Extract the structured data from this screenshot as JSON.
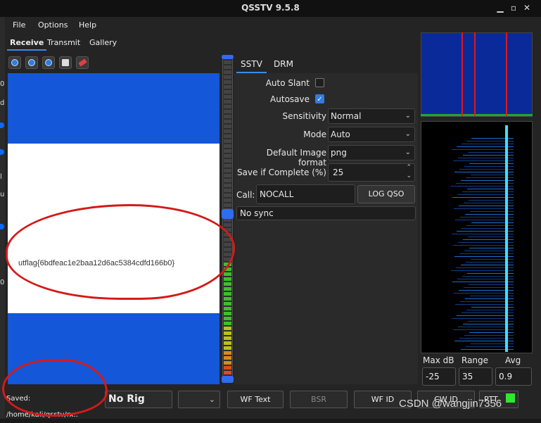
{
  "window": {
    "title": "QSSTV 9.5.8"
  },
  "menu": [
    "File",
    "Options",
    "Help"
  ],
  "tabs": [
    "Receive",
    "Transmit",
    "Gallery"
  ],
  "image": {
    "text": "utflag{6bdfeac1e2baa12d6ac5384cdfd166b0}"
  },
  "panel": {
    "tabs": [
      "SSTV",
      "DRM"
    ],
    "auto_slant_label": "Auto Slant",
    "auto_slant": false,
    "autosave_label": "Autosave",
    "autosave": true,
    "sensitivity_label": "Sensitivity",
    "sensitivity": "Normal",
    "mode_label": "Mode",
    "mode": "Auto",
    "format_label": "Default Image format",
    "format": "png",
    "save_label": "Save if Complete (%)",
    "save_value": "25",
    "call_label": "Call:",
    "call_value": "NOCALL",
    "log_label": "LOG QSO",
    "sync_status": "No sync"
  },
  "waterfall": {
    "max_db_label": "Max dB",
    "range_label": "Range",
    "avg_label": "Avg",
    "max_db": "-25",
    "range": "35",
    "avg": "0.9"
  },
  "status": {
    "saved": "Saved: /home/kali/qsstv/rx..",
    "rig": "No Rig",
    "wf_text": "WF Text",
    "bsr": "BSR",
    "wf_id": "WF ID",
    "cw_id": "CW ID",
    "ptt": "PTT"
  },
  "watermark": "CSDN @wangjin7356",
  "left_strip_chars": [
    "0",
    "d",
    "l",
    "u",
    "l",
    "0",
    "0"
  ],
  "colors": {
    "accent": "#2f7de0",
    "image_blue": "#1457d8",
    "annotation_red": "#d41a1a",
    "ptt_green": "#2ee82e"
  }
}
